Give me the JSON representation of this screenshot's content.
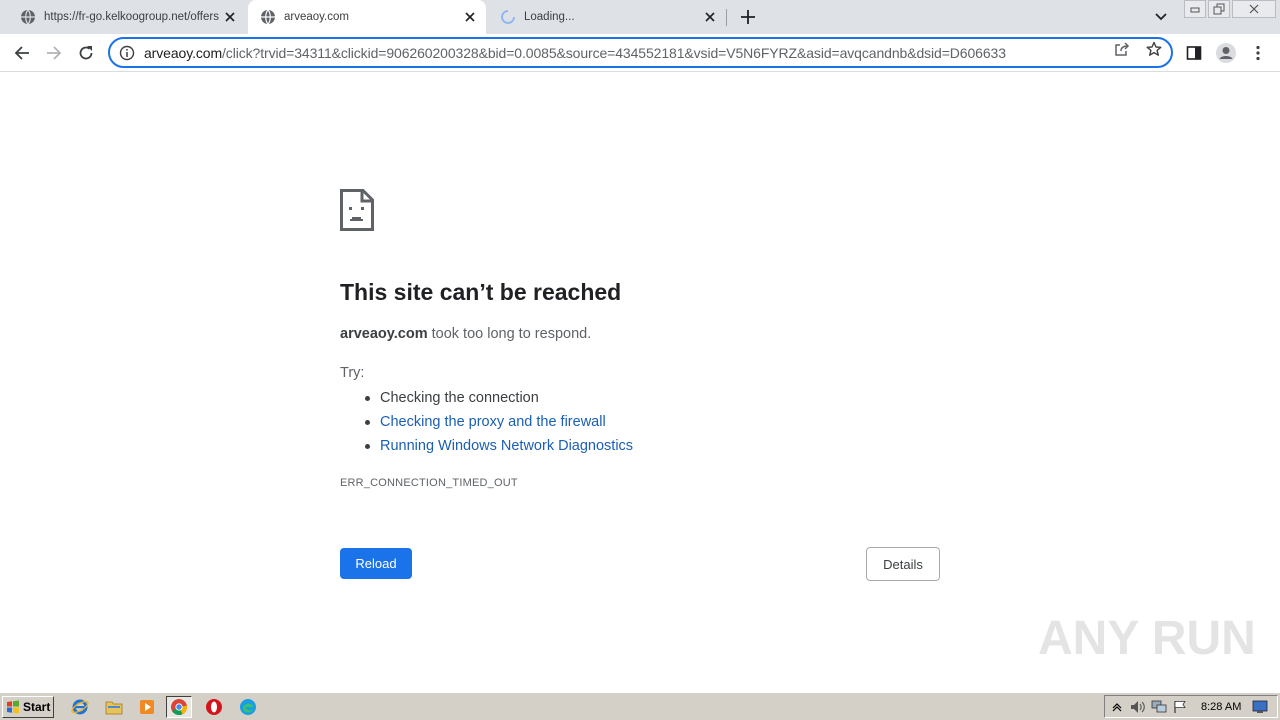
{
  "tabs": [
    {
      "title": "https://fr-go.kelkoogroup.net/offers",
      "icon": "globe-icon",
      "active": false
    },
    {
      "title": "arveaoy.com",
      "icon": "globe-icon",
      "active": true
    },
    {
      "title": "Loading...",
      "icon": "loading-spinner-icon",
      "active": false
    }
  ],
  "toolbar": {
    "url_host": "arveaoy.com",
    "url_rest": "/click?trvid=34311&clickid=906260200328&bid=0.0085&source=434552181&vsid=V5N6FYRZ&asid=avqcandnb&dsid=D606633"
  },
  "error": {
    "title": "This site can’t be reached",
    "host": "arveaoy.com",
    "message": " took too long to respond.",
    "try_label": "Try:",
    "suggestions": [
      "Checking the connection",
      "Checking the proxy and the firewall",
      "Running Windows Network Diagnostics"
    ],
    "code": "ERR_CONNECTION_TIMED_OUT",
    "reload_label": "Reload",
    "details_label": "Details"
  },
  "watermark": "ANY RUN",
  "taskbar": {
    "start_label": "Start",
    "clock": "8:28 AM"
  },
  "colors": {
    "accent": "#1a73e8",
    "link": "#1a5fb4",
    "tabstrip": "#dee1e6",
    "taskbar": "#d4d0c8"
  }
}
